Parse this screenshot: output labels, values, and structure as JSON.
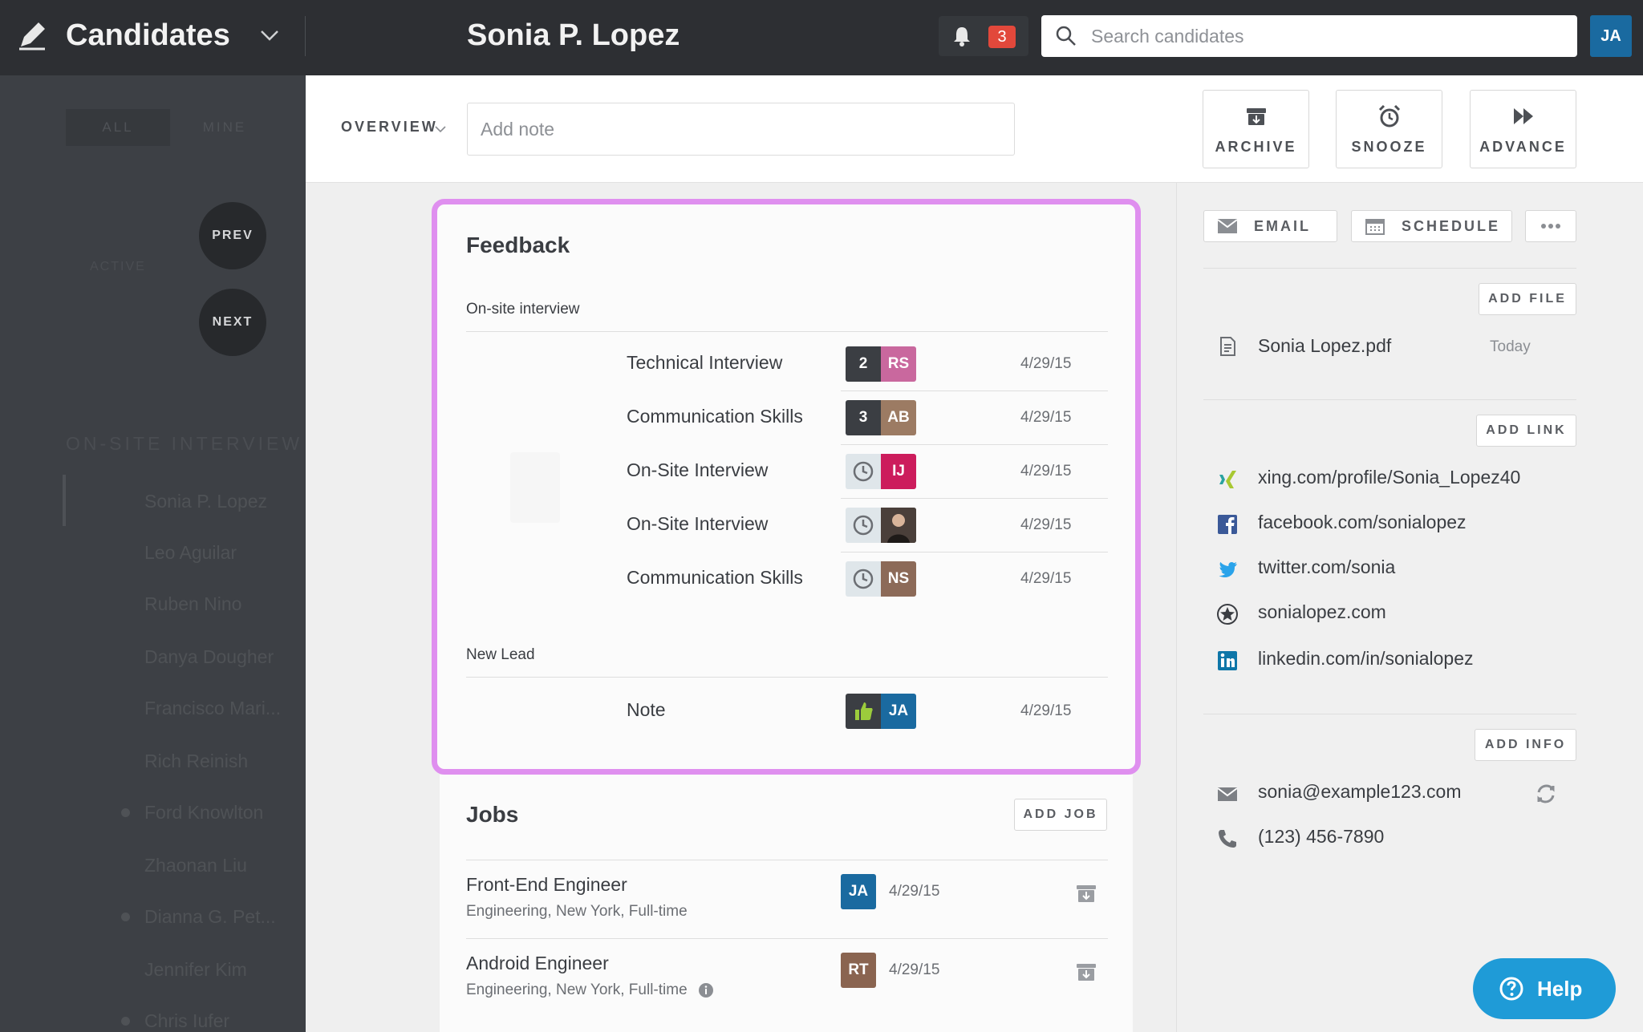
{
  "topbar": {
    "app_title": "Candidates",
    "candidate_name": "Sonia P. Lopez",
    "notification_count": "3",
    "search_placeholder": "Search candidates",
    "user_initials": "JA"
  },
  "sidebar": {
    "tabs": [
      "ALL",
      "MINE"
    ],
    "active_label": "ACTIVE",
    "prev_label": "PREV",
    "next_label": "NEXT",
    "section_title": "ON-SITE INTERVIEW",
    "candidates": [
      "Sonia P. Lopez",
      "Leo Aguilar",
      "Ruben Nino",
      "Danya Dougher",
      "Francisco Mari...",
      "Rich Reinish",
      "Ford Knowlton",
      "Zhaonan Liu",
      "Dianna G. Pet...",
      "Jennifer Kim",
      "Chris Iufer"
    ]
  },
  "header": {
    "overview_label": "OVERVIEW",
    "note_placeholder": "Add note",
    "archive_label": "ARCHIVE",
    "snooze_label": "SNOOZE",
    "advance_label": "ADVANCE"
  },
  "feedback": {
    "title": "Feedback",
    "groups": [
      {
        "name": "On-site interview",
        "items": [
          {
            "label": "Technical Interview",
            "score": "2",
            "initials": "RS",
            "date": "4/29/15"
          },
          {
            "label": "Communication Skills",
            "score": "3",
            "initials": "AB",
            "date": "4/29/15"
          },
          {
            "label": "On-Site Interview",
            "score": "",
            "initials": "IJ",
            "date": "4/29/15"
          },
          {
            "label": "On-Site Interview",
            "score": "",
            "initials": "",
            "date": "4/29/15"
          },
          {
            "label": "Communication Skills",
            "score": "",
            "initials": "NS",
            "date": "4/29/15"
          }
        ]
      },
      {
        "name": "New Lead",
        "items": [
          {
            "label": "Note",
            "score": "",
            "initials": "JA",
            "date": "4/29/15"
          }
        ]
      }
    ]
  },
  "jobs": {
    "title": "Jobs",
    "add_label": "ADD JOB",
    "items": [
      {
        "title": "Front-End Engineer",
        "subtitle": "Engineering, New York, Full-time",
        "initials": "JA",
        "date": "4/29/15"
      },
      {
        "title": "Android Engineer",
        "subtitle": "Engineering, New York, Full-time",
        "initials": "RT",
        "date": "4/29/15"
      }
    ]
  },
  "right_panel": {
    "email_label": "EMAIL",
    "schedule_label": "SCHEDULE",
    "add_file_label": "ADD FILE",
    "file_name": "Sonia Lopez.pdf",
    "file_date": "Today",
    "add_link_label": "ADD LINK",
    "links": [
      "xing.com/profile/Sonia_Lopez40",
      "facebook.com/sonialopez",
      "twitter.com/sonia",
      "sonialopez.com",
      "linkedin.com/in/sonialopez"
    ],
    "add_info_label": "ADD INFO",
    "email": "sonia@example123.com",
    "phone": "(123) 456-7890"
  },
  "help_label": "Help",
  "colors": {
    "topbar": "#2d2f33",
    "highlight": "#df8fef",
    "help": "#1f9bd7",
    "notification": "#e2483b"
  }
}
